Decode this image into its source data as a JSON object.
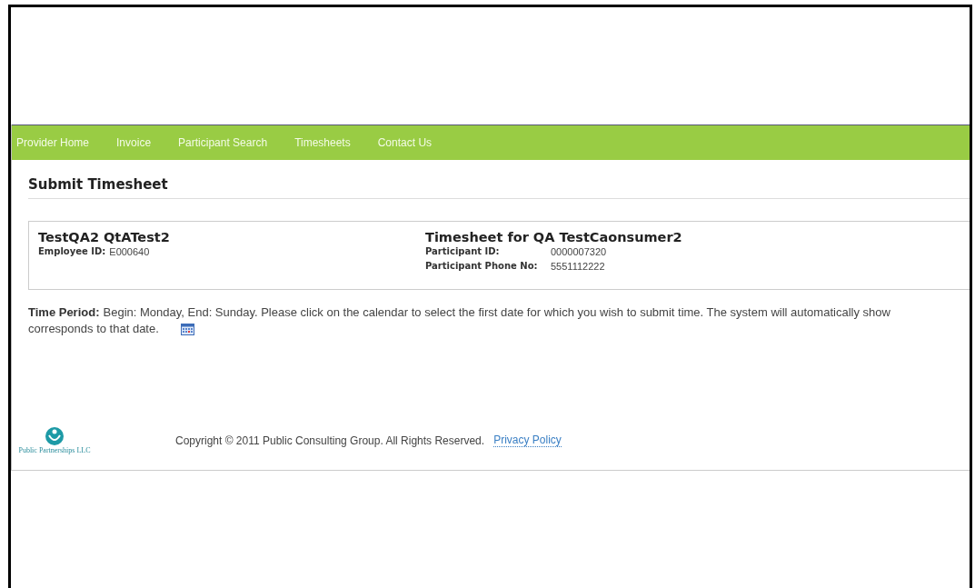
{
  "nav": [
    {
      "label": "Provider Home"
    },
    {
      "label": "Invoice"
    },
    {
      "label": "Participant Search"
    },
    {
      "label": "Timesheets"
    },
    {
      "label": "Contact Us"
    }
  ],
  "page_title": "Submit Timesheet",
  "employee": {
    "name": "TestQA2 QtATest2",
    "id_label": "Employee ID:",
    "id_value": "E000640"
  },
  "participant": {
    "title": "Timesheet for QA TestCaonsumer2",
    "fields": [
      {
        "label": "Participant ID:",
        "value": "0000007320"
      },
      {
        "label": "Participant Phone No:",
        "value": "5551112222"
      }
    ]
  },
  "time_period": {
    "label": "Time Period:",
    "line_1": "Begin: Monday, End: Sunday. Please click on the calendar to select the first date for which you wish to submit time. The system will automatically show",
    "line_2": "corresponds to that date."
  },
  "footer": {
    "logo_text_1": "Public",
    "logo_text_2": "Partnerships",
    "logo_text_3": "LLC",
    "copyright": "Copyright © 2011 Public Consulting Group. All Rights Reserved.",
    "link": "Privacy Policy"
  }
}
